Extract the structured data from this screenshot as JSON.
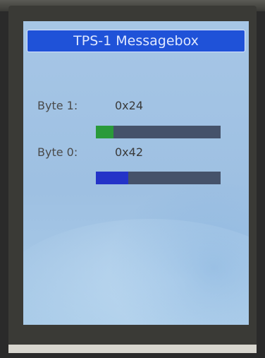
{
  "window": {
    "title": "TPS-1 Messagebox"
  },
  "rows": [
    {
      "label": "Byte 1:",
      "value": "0x24",
      "level": 0.14,
      "color": "#2a9a3a"
    },
    {
      "label": "Byte 0:",
      "value": "0x42",
      "level": 0.26,
      "color": "#2433c8"
    }
  ],
  "colors": {
    "titlebar": "#1f52d8",
    "track": "#45526a"
  }
}
